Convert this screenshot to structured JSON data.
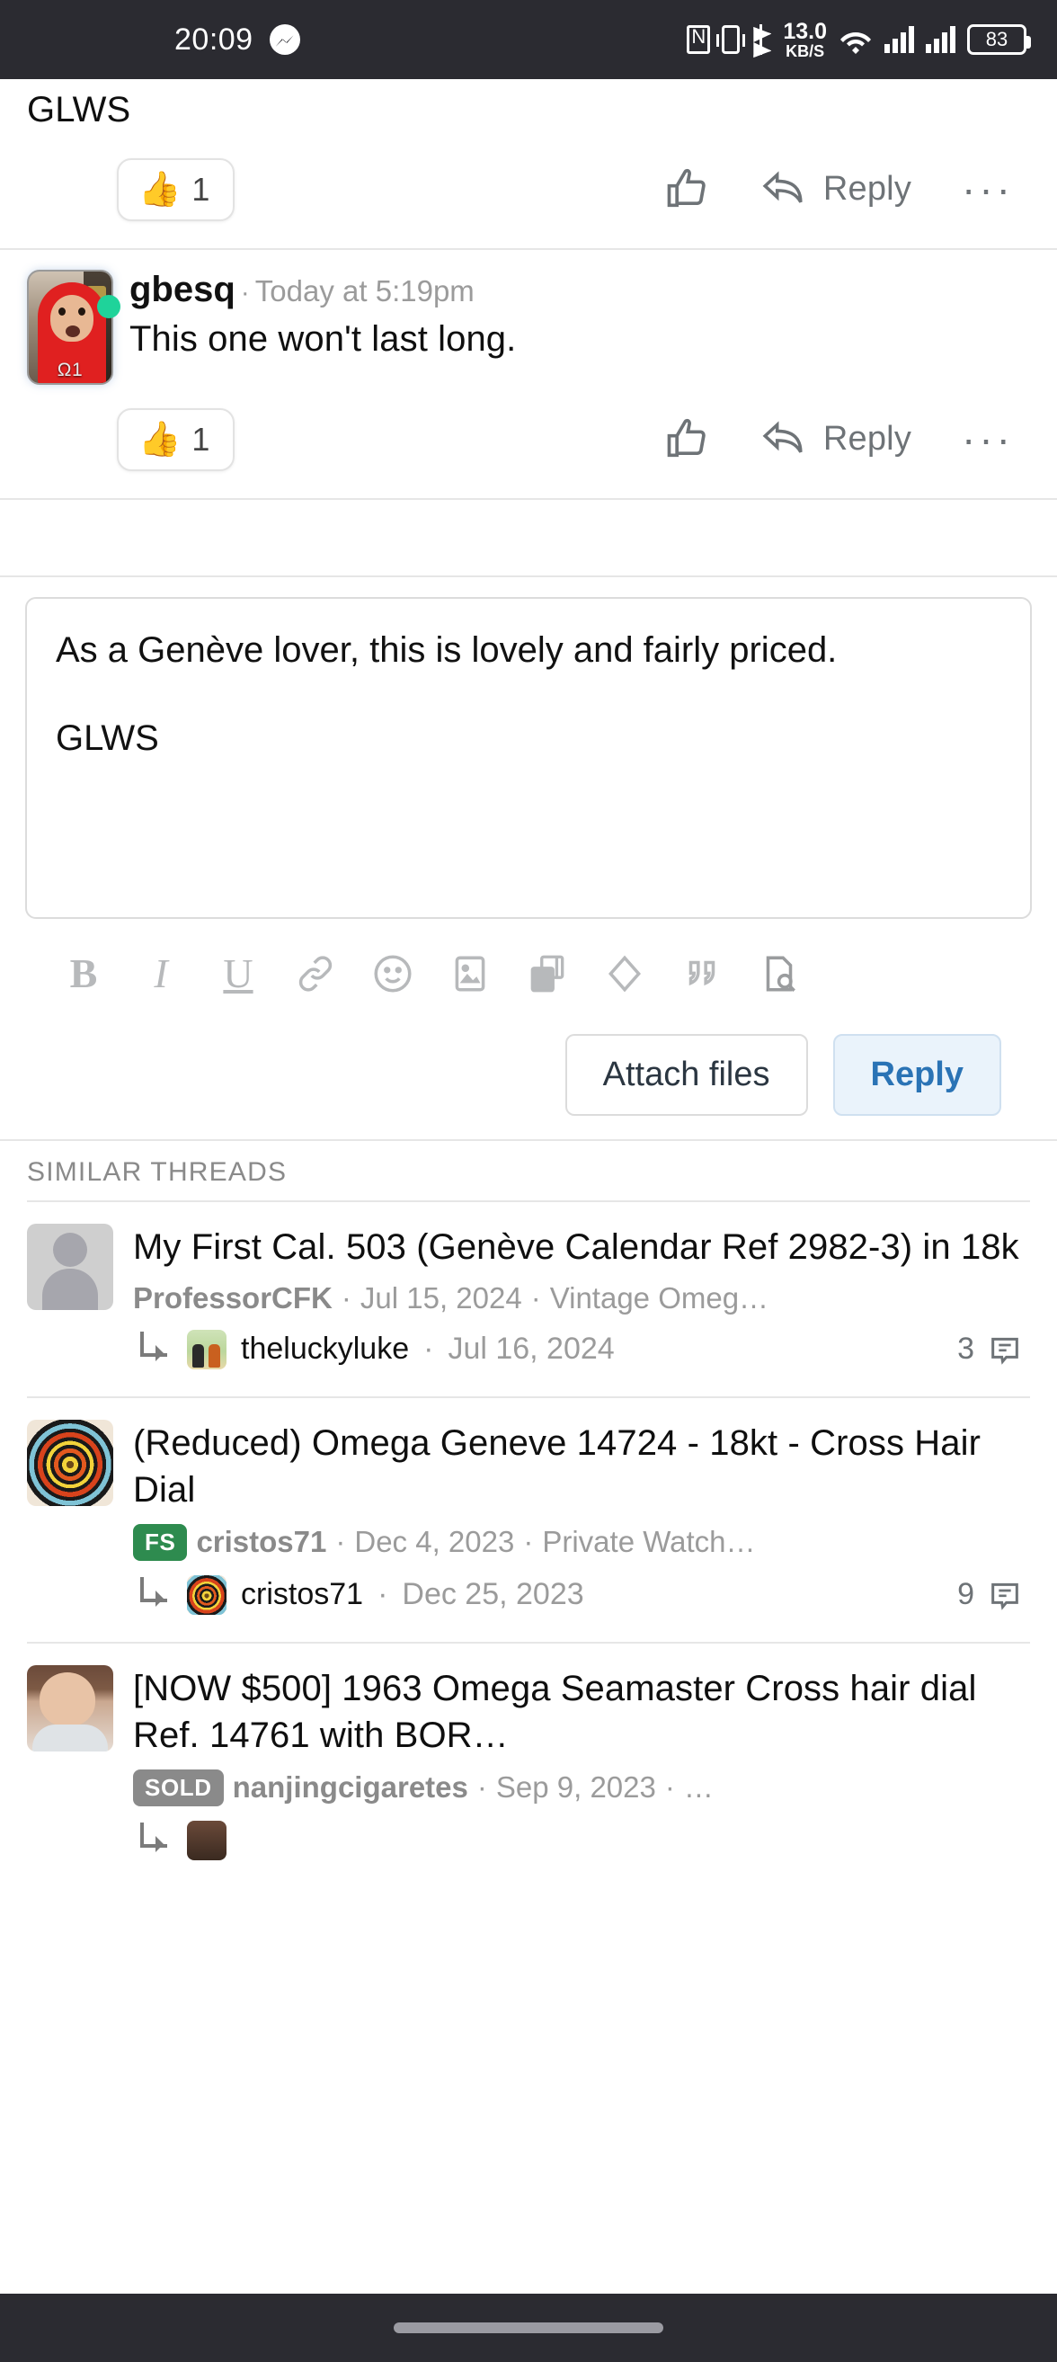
{
  "status_bar": {
    "time": "20:09",
    "icons": [
      "messenger-icon",
      "nfc-icon",
      "vibrate-icon",
      "bluetooth-icon",
      "network-speed",
      "wifi-icon",
      "signal-1-icon",
      "signal-2-icon",
      "battery-icon"
    ],
    "network_speed_value": "13.0",
    "network_speed_unit": "KB/S",
    "battery_percent": "83"
  },
  "posts": [
    {
      "text": "GLWS",
      "reaction_emoji": "👍",
      "reaction_count": "1",
      "like_label": "",
      "reply_label": "Reply",
      "more_label": "···"
    },
    {
      "username": "gbesq",
      "separator": "·",
      "timestamp": "Today at 5:19pm",
      "avatar_tag": "Ω1",
      "text": "This one won't last long.",
      "reaction_emoji": "👍",
      "reaction_count": "1",
      "reply_label": "Reply",
      "more_label": "···"
    }
  ],
  "editor": {
    "line1": "As a Genève lover, this is lovely and fairly priced.",
    "line2": "GLWS",
    "toolbar": [
      {
        "name": "bold-icon",
        "glyph": "B"
      },
      {
        "name": "italic-icon",
        "glyph": "I"
      },
      {
        "name": "underline-icon",
        "glyph": "U"
      },
      {
        "name": "link-icon",
        "glyph": ""
      },
      {
        "name": "emoji-icon",
        "glyph": ""
      },
      {
        "name": "image-icon",
        "glyph": ""
      },
      {
        "name": "media-gallery-icon",
        "glyph": ""
      },
      {
        "name": "clear-formatting-icon",
        "glyph": ""
      },
      {
        "name": "quote-icon",
        "glyph": ""
      },
      {
        "name": "preview-icon",
        "glyph": ""
      }
    ],
    "attach_label": "Attach files",
    "reply_label": "Reply"
  },
  "similar_threads": {
    "section_title": "SIMILAR THREADS",
    "items": [
      {
        "title": "My First Cal. 503 (Genève Calendar Ref 2982-3) in 18k",
        "author": "ProfessorCFK",
        "date": "Jul 15, 2024",
        "forum": "Vintage Omeg…",
        "badge": "",
        "last_user": "theluckyluke",
        "last_date": "Jul 16, 2024",
        "reply_count": "3",
        "sep": "·"
      },
      {
        "title": "(Reduced) Omega Geneve 14724 - 18kt - Cross Hair Dial",
        "author": "cristos71",
        "date": "Dec 4, 2023",
        "forum": "Private Watch…",
        "badge": "FS",
        "last_user": "cristos71",
        "last_date": "Dec 25, 2023",
        "reply_count": "9",
        "sep": "·"
      },
      {
        "title": "[NOW $500] 1963 Omega Seamaster Cross hair dial Ref. 14761 with BOR…",
        "author": "nanjingcigaretes",
        "date": "Sep 9, 2023",
        "forum": "…",
        "badge": "SOLD",
        "last_user": "",
        "last_date": "",
        "reply_count": "",
        "sep": "·"
      }
    ]
  },
  "colors": {
    "accent_blue": "#2a73b5",
    "status_bar_bg": "#2b2b31",
    "muted_text": "#9b9b9b",
    "icon_grey": "#6e7377",
    "badge_fs": "#2e8b4f",
    "badge_sold": "#8a8a8a",
    "online_dot": "#1fd39a"
  }
}
